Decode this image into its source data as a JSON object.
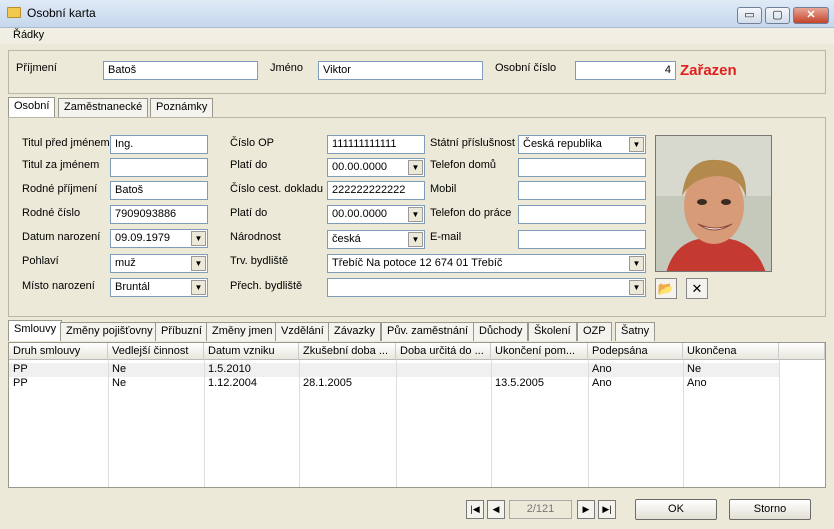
{
  "window": {
    "title": "Osobní karta",
    "min": "▭",
    "max": "▢",
    "close": "✕"
  },
  "menu": {
    "items": [
      "Řádky"
    ]
  },
  "header": {
    "surname_label": "Příjmení",
    "surname": "Batoš",
    "name_label": "Jméno",
    "name": "Viktor",
    "id_label": "Osobní číslo",
    "id": "4",
    "status": "Zařazen",
    "status_color": "#e02020"
  },
  "top_tabs": [
    "Osobní",
    "Zaměstnanecké",
    "Poznámky"
  ],
  "personal": {
    "title_before_label": "Titul před jménem",
    "title_before": "Ing.",
    "title_after_label": "Titul za jménem",
    "title_after": "",
    "birth_surname_label": "Rodné příjmení",
    "birth_surname": "Batoš",
    "birth_number_label": "Rodné číslo",
    "birth_number": "7909093886",
    "birth_date_label": "Datum narození",
    "birth_date": "09.09.1979",
    "sex_label": "Pohlaví",
    "sex": "muž",
    "birth_place_label": "Místo narození",
    "birth_place": "Bruntál",
    "id_card_label": "Číslo OP",
    "id_card": "111111111111",
    "valid_to_label": "Platí do",
    "valid_to": "00.00.0000",
    "passport_label": "Číslo cest. dokladu",
    "passport": "222222222222",
    "valid_to2_label": "Platí do",
    "valid_to2": "00.00.0000",
    "nationality_label": "Národnost",
    "nationality": "česká",
    "permanent_label": "Trv. bydliště",
    "permanent": "Třebíč  Na potoce 12   674 01 Třebíč",
    "temporary_label": "Přech. bydliště",
    "temporary": "",
    "citizenship_label": "Státní příslušnost",
    "citizenship": "Česká republika",
    "phone_home_label": "Telefon domů",
    "phone_home": "",
    "mobile_label": "Mobil",
    "mobile": "",
    "phone_work_label": "Telefon do práce",
    "phone_work": "",
    "email_label": "E-mail",
    "email": ""
  },
  "bottom_tabs": [
    "Smlouvy",
    "Změny pojišťovny",
    "Příbuzní",
    "Změny jmen",
    "Vzdělání",
    "Závazky",
    "Pův. zaměstnání",
    "Důchody",
    "Školení",
    "OZP",
    "Šatny"
  ],
  "table": {
    "columns": [
      "Druh smlouvy",
      "Vedlejší činnost",
      "Datum vzniku",
      "Zkušební doba ...",
      "Doba určitá do ...",
      "Ukončení pom...",
      "Podepsána",
      "Ukončena"
    ],
    "rows": [
      [
        "PP",
        "Ne",
        "1.5.2010",
        "",
        "",
        "",
        "Ano",
        "Ne"
      ],
      [
        "PP",
        "Ne",
        "1.12.2004",
        "28.1.2005",
        "",
        "13.5.2005",
        "Ano",
        "Ano"
      ]
    ]
  },
  "footer": {
    "position": "2/121",
    "ok": "OK",
    "cancel": "Storno"
  }
}
